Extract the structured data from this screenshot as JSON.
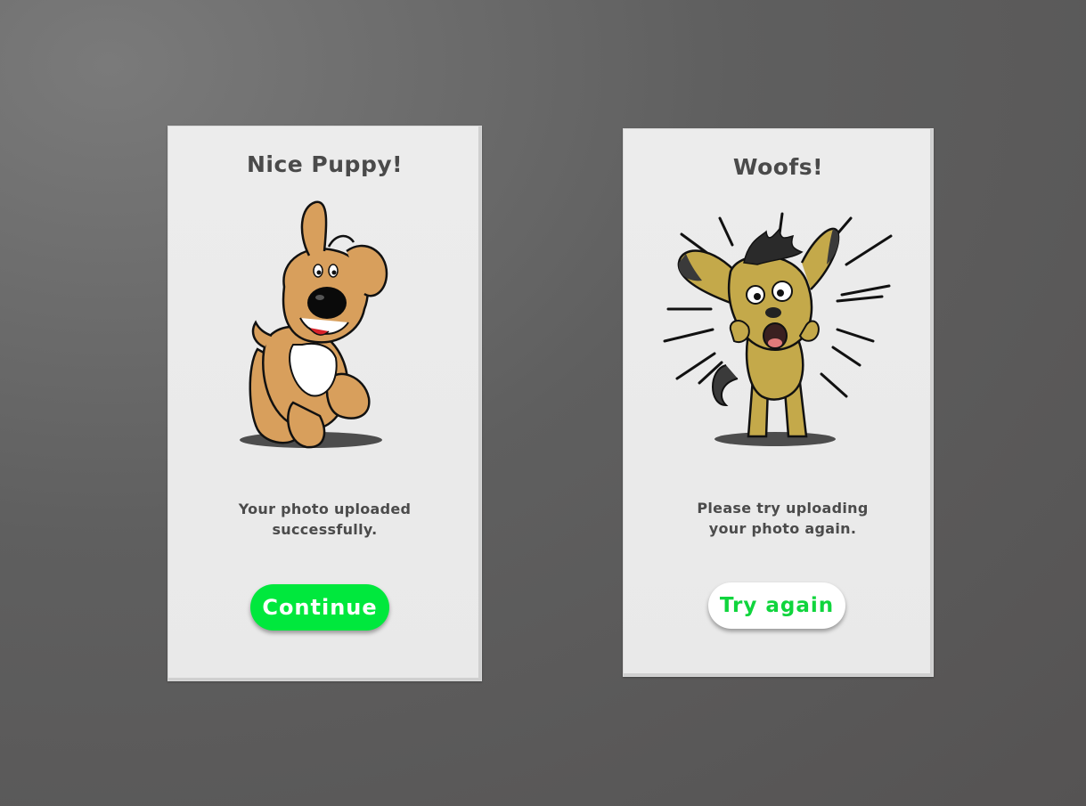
{
  "success_card": {
    "title": "Nice Puppy!",
    "illustration_icon": "happy-dog-icon",
    "message": "Your photo uploaded successfully.",
    "button_label": "Continue",
    "button_color": "#00e83d"
  },
  "error_card": {
    "title": "Woofs!",
    "illustration_icon": "scared-dog-icon",
    "message": "Please try uploading your photo again.",
    "button_label": "Try again",
    "button_text_color": "#10d53d"
  }
}
